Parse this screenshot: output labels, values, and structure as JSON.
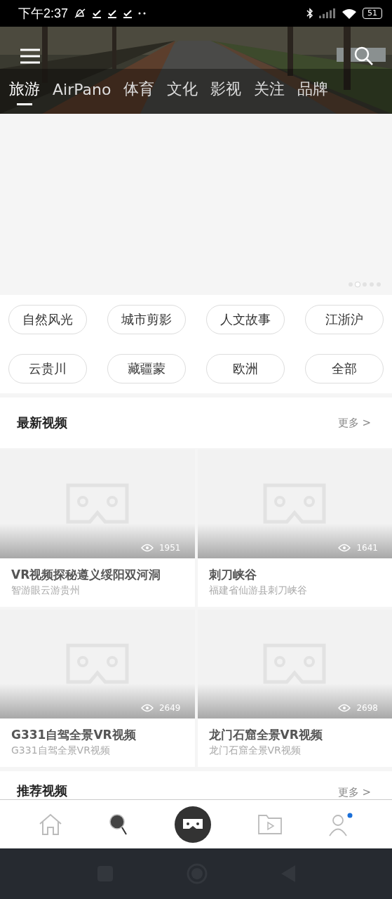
{
  "status_bar": {
    "time": "下午2:37",
    "battery": "51"
  },
  "tabs": [
    {
      "label": "旅游",
      "selected": true
    },
    {
      "label": "AirPano",
      "selected": false
    },
    {
      "label": "体育",
      "selected": false
    },
    {
      "label": "文化",
      "selected": false
    },
    {
      "label": "影视",
      "selected": false
    },
    {
      "label": "关注",
      "selected": false
    },
    {
      "label": "品牌",
      "selected": false
    }
  ],
  "banner": {
    "dots": [
      {
        "selected": false
      },
      {
        "selected": true
      },
      {
        "selected": false
      },
      {
        "selected": false
      },
      {
        "selected": false
      }
    ]
  },
  "categories": [
    "自然风光",
    "城市剪影",
    "人文故事",
    "江浙沪",
    "云贵川",
    "藏疆蒙",
    "欧洲",
    "全部"
  ],
  "sections": [
    {
      "title": "最新视频",
      "more": "更多 >",
      "videos": [
        {
          "views": "1951",
          "title": "VR视频探秘遵义绥阳双河洞",
          "subtitle": "智游眼云游贵州"
        },
        {
          "views": "1641",
          "title": "刺刀峡谷",
          "subtitle": "福建省仙游县刺刀峡谷"
        },
        {
          "views": "2649",
          "title": "G331自驾全景VR视频",
          "subtitle": "G331自驾全景VR视频"
        },
        {
          "views": "2698",
          "title": "龙门石窟全景VR视频",
          "subtitle": "龙门石窟全景VR视频"
        }
      ]
    },
    {
      "title": "推荐视频",
      "more": "更多 >"
    }
  ],
  "bottom_nav": [
    {
      "kind": "home",
      "selected": false
    },
    {
      "kind": "discover",
      "selected": false
    },
    {
      "kind": "vr",
      "selected": true
    },
    {
      "kind": "folder",
      "selected": false
    },
    {
      "kind": "profile",
      "selected": false,
      "notification": true
    }
  ]
}
